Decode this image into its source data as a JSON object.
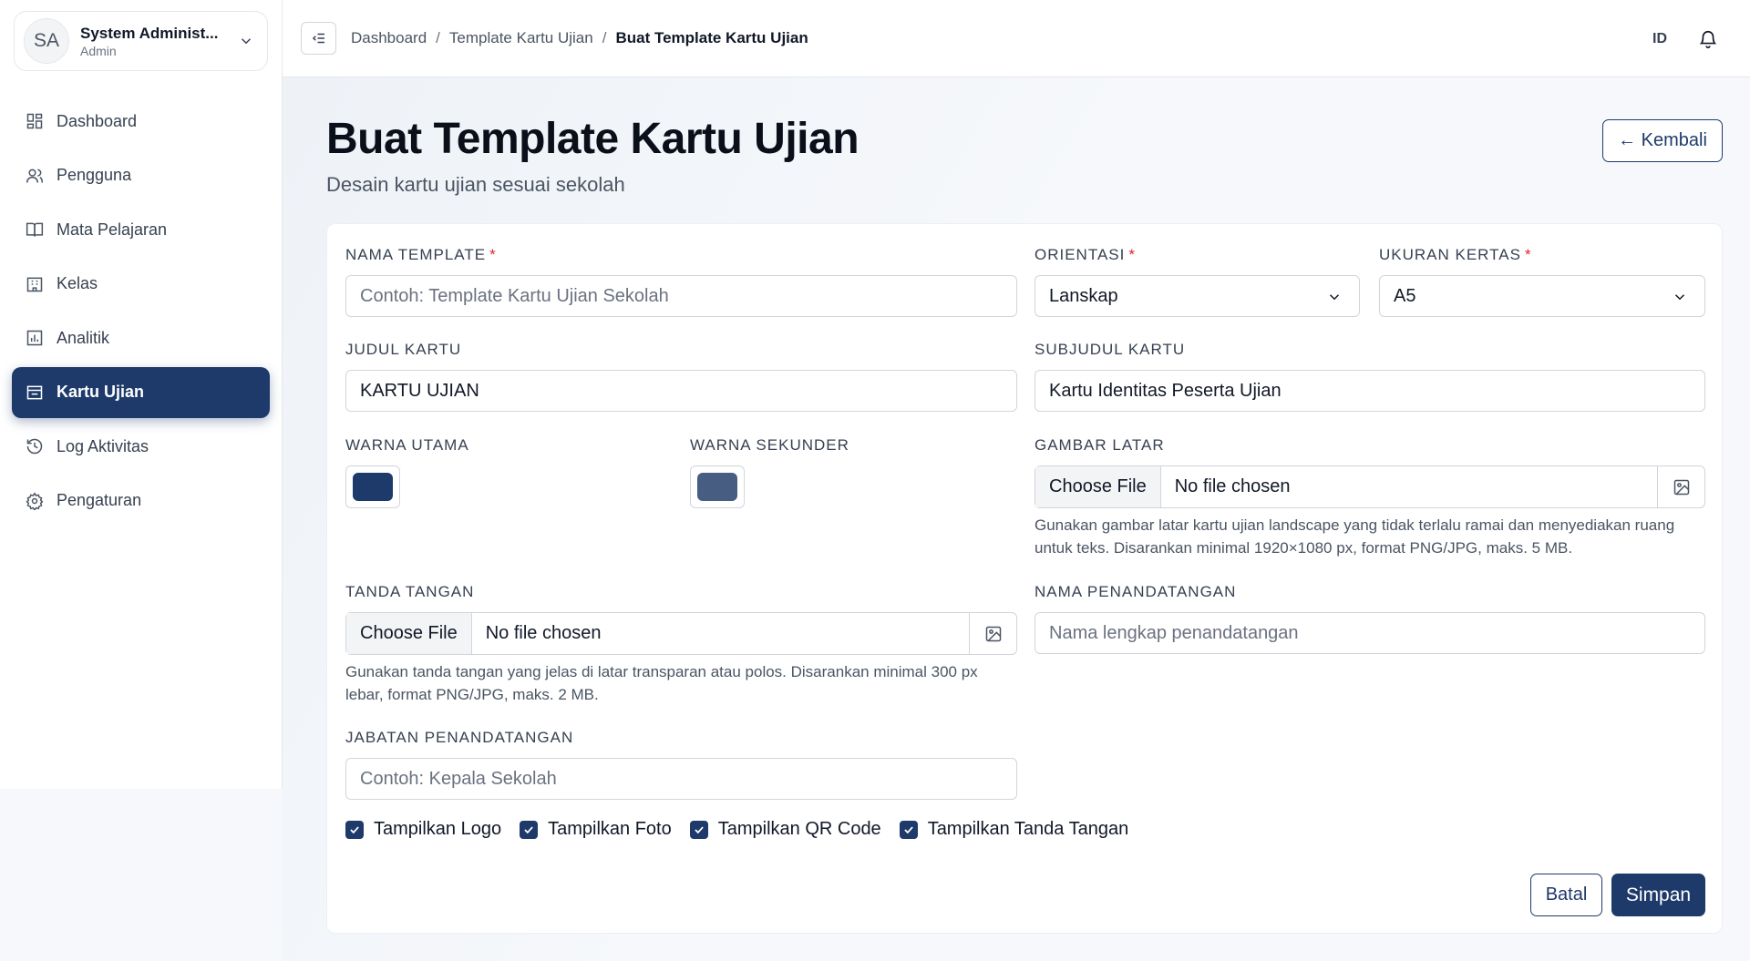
{
  "user": {
    "initials": "SA",
    "name": "System Administ...",
    "role": "Admin"
  },
  "nav": {
    "items": [
      {
        "label": "Dashboard"
      },
      {
        "label": "Pengguna"
      },
      {
        "label": "Mata Pelajaran"
      },
      {
        "label": "Kelas"
      },
      {
        "label": "Analitik"
      },
      {
        "label": "Kartu Ujian"
      },
      {
        "label": "Log Aktivitas"
      },
      {
        "label": "Pengaturan"
      }
    ],
    "active": "Kartu Ujian"
  },
  "breadcrumb": {
    "items": [
      "Dashboard",
      "Template Kartu Ujian"
    ],
    "current": "Buat Template Kartu Ujian",
    "separator": "/"
  },
  "header": {
    "language": "ID"
  },
  "page": {
    "title": "Buat Template Kartu Ujian",
    "subtitle": "Desain kartu ujian sesuai sekolah",
    "back_label": "← Kembali"
  },
  "form": {
    "nama_template": {
      "label": "NAMA TEMPLATE",
      "required": "*",
      "placeholder": "Contoh: Template Kartu Ujian Sekolah"
    },
    "orientasi": {
      "label": "ORIENTASI",
      "required": "*",
      "value": "Lanskap"
    },
    "ukuran_kertas": {
      "label": "UKURAN KERTAS",
      "required": "*",
      "value": "A5"
    },
    "judul_kartu": {
      "label": "JUDUL KARTU",
      "value": "KARTU UJIAN"
    },
    "subjudul_kartu": {
      "label": "SUBJUDUL KARTU",
      "value": "Kartu Identitas Peserta Ujian"
    },
    "warna_utama": {
      "label": "WARNA UTAMA",
      "color": "#1e3a6b"
    },
    "warna_sekunder": {
      "label": "WARNA SEKUNDER",
      "color": "#475d82"
    },
    "gambar_latar": {
      "label": "GAMBAR LATAR",
      "choose": "Choose File",
      "status": "No file chosen",
      "help": "Gunakan gambar latar kartu ujian landscape yang tidak terlalu ramai dan menyediakan ruang untuk teks. Disarankan minimal 1920×1080 px, format PNG/JPG, maks. 5 MB."
    },
    "tanda_tangan": {
      "label": "TANDA TANGAN",
      "choose": "Choose File",
      "status": "No file chosen",
      "help": "Gunakan tanda tangan yang jelas di latar transparan atau polos. Disarankan minimal 300 px lebar, format PNG/JPG, maks. 2 MB."
    },
    "nama_penandatangan": {
      "label": "NAMA PENANDATANGAN",
      "placeholder": "Nama lengkap penandatangan"
    },
    "jabatan_penandatangan": {
      "label": "JABATAN PENANDATANGAN",
      "placeholder": "Contoh: Kepala Sekolah"
    },
    "checkboxes": [
      {
        "label": "Tampilkan Logo",
        "checked": true
      },
      {
        "label": "Tampilkan Foto",
        "checked": true
      },
      {
        "label": "Tampilkan QR Code",
        "checked": true
      },
      {
        "label": "Tampilkan Tanda Tangan",
        "checked": true
      }
    ],
    "cancel_label": "Batal",
    "save_label": "Simpan"
  },
  "colors": {
    "primary": "#1e3a6b",
    "danger": "#dc2626"
  }
}
